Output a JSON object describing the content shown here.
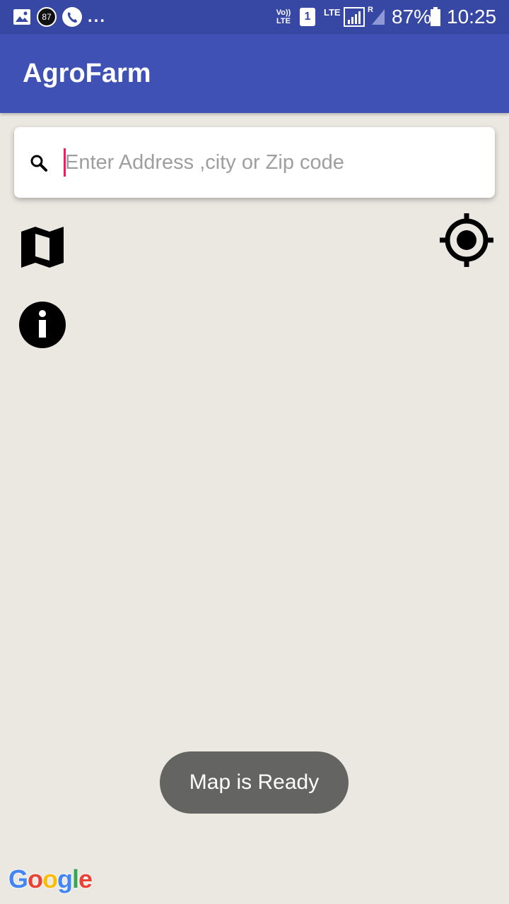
{
  "status_bar": {
    "notification_badge": "87",
    "more": "...",
    "volte": "Vo)) LTE",
    "sim_slot": "1",
    "network": "LTE",
    "roaming": "R",
    "battery": "87%",
    "time": "10:25"
  },
  "app_bar": {
    "title": "AgroFarm"
  },
  "search": {
    "placeholder": "Enter Address ,city or Zip code",
    "value": ""
  },
  "map_controls": {
    "map_type_icon": "map-icon",
    "info_icon": "info-icon",
    "my_location_icon": "my-location-icon"
  },
  "toast": {
    "message": "Map is Ready"
  },
  "attribution": {
    "letters": [
      "G",
      "o",
      "o",
      "g",
      "l",
      "e"
    ],
    "colors": [
      "#4285f4",
      "#ea4335",
      "#fbbc05",
      "#4285f4",
      "#34a853",
      "#ea4335"
    ]
  },
  "colors": {
    "status_bar": "#3747a4",
    "app_bar": "#3f51b5",
    "map_background": "#ebe8e1",
    "cursor": "#e91e63",
    "toast": "#646462"
  }
}
